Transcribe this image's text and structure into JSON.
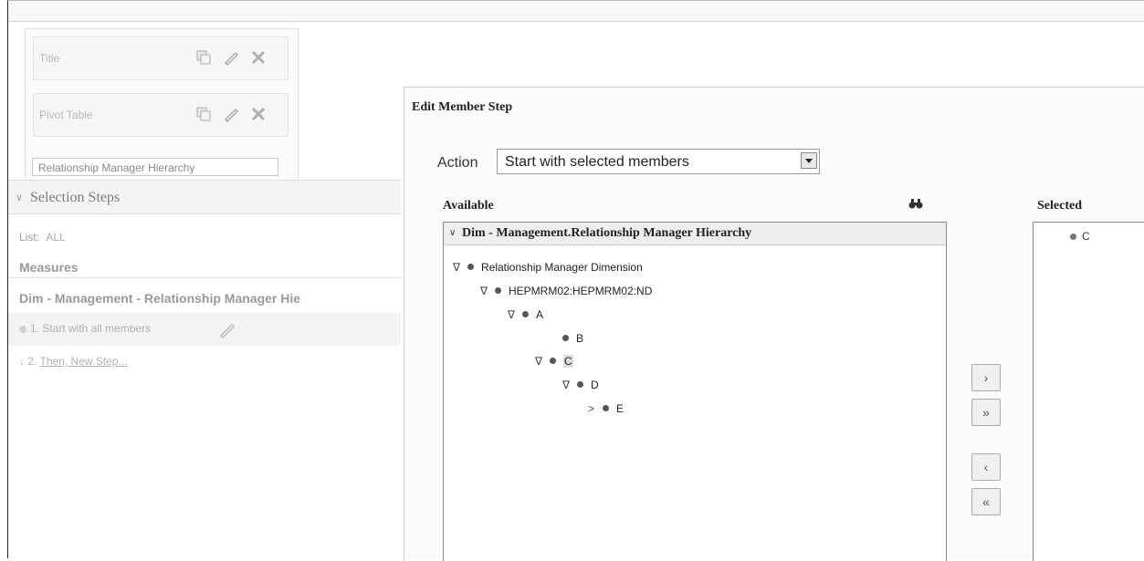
{
  "left_panel": {
    "views": [
      {
        "label": "Title"
      },
      {
        "label": "Pivot Table"
      }
    ],
    "hierarchy_field": "Relationship Manager Hierarchy",
    "selection_steps": {
      "title": "Selection Steps",
      "list_label": "List:",
      "list_value": "ALL",
      "measures_label": "Measures",
      "dim_title": "Dim - Management - Relationship Manager Hie",
      "step1": "1. Start with all members",
      "step2_prefix": "2.",
      "step2_link": "Then, New Step..."
    }
  },
  "dialog": {
    "title": "Edit Member Step",
    "action_label": "Action",
    "action_value": "Start with selected members",
    "available_label": "Available",
    "dim_header": "Dim - Management.Relationship Manager Hierarchy",
    "tree": [
      {
        "label": "Relationship Manager Dimension",
        "twisty": "∇"
      },
      {
        "label": "HEPMRM02:HEPMRM02:ND",
        "twisty": "∇"
      },
      {
        "label": "A",
        "twisty": "∇"
      },
      {
        "label": "B",
        "twisty": ""
      },
      {
        "label": "C",
        "twisty": "∇"
      },
      {
        "label": "D",
        "twisty": "∇"
      },
      {
        "label": "E",
        "twisty": ">"
      }
    ],
    "move_buttons": [
      "›",
      "»",
      "‹",
      "«"
    ],
    "selected_label": "Selected",
    "selected_items": [
      "C"
    ]
  },
  "colors": {
    "dialog_bg": "#fbfbfb",
    "border": "#8a8a8a"
  }
}
